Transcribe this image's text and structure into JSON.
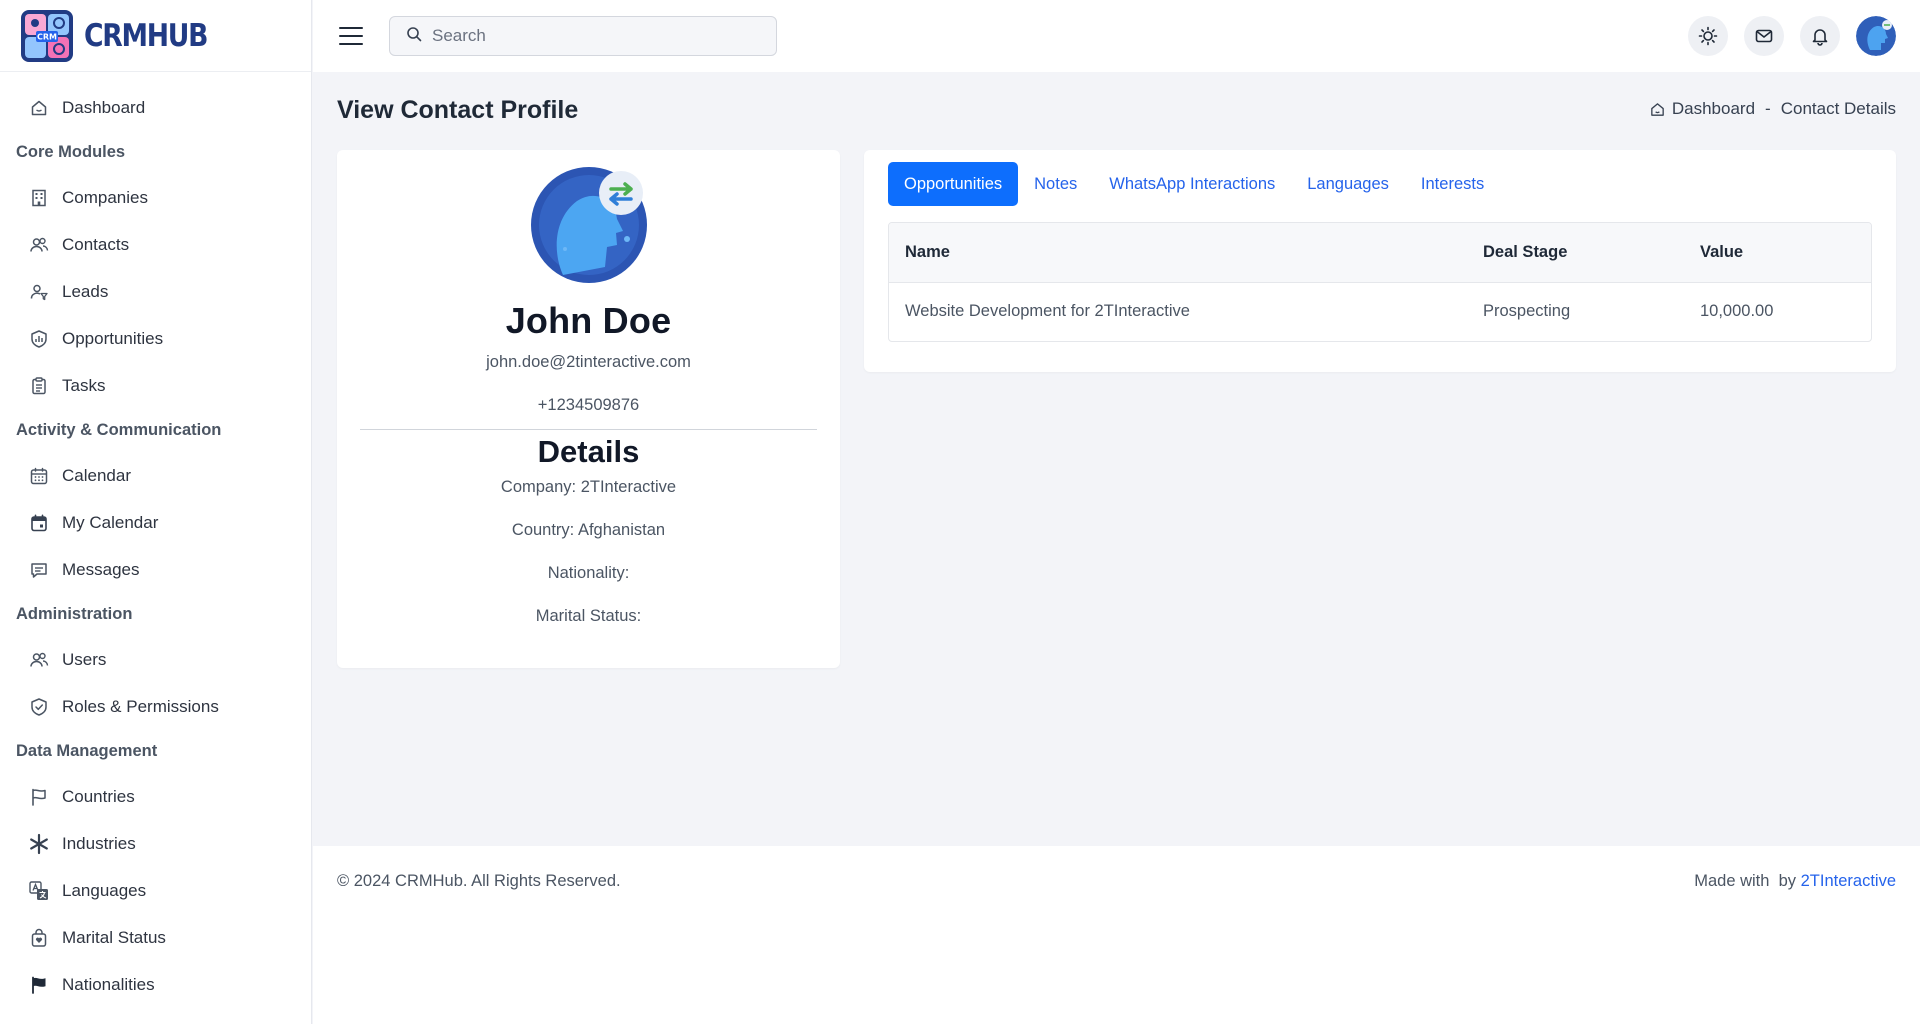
{
  "brand": {
    "name": "CRMHUB",
    "logo_badge": "CRM"
  },
  "sidebar": {
    "items": [
      {
        "type": "item",
        "label": "Dashboard",
        "icon": "home-icon"
      },
      {
        "type": "section",
        "label": "Core Modules"
      },
      {
        "type": "item",
        "label": "Companies",
        "icon": "building-icon"
      },
      {
        "type": "item",
        "label": "Contacts",
        "icon": "users-icon"
      },
      {
        "type": "item",
        "label": "Leads",
        "icon": "user-filter-icon"
      },
      {
        "type": "item",
        "label": "Opportunities",
        "icon": "chart-shield-icon"
      },
      {
        "type": "item",
        "label": "Tasks",
        "icon": "clipboard-icon"
      },
      {
        "type": "section",
        "label": "Activity & Communication"
      },
      {
        "type": "item",
        "label": "Calendar",
        "icon": "calendar-icon"
      },
      {
        "type": "item",
        "label": "My Calendar",
        "icon": "calendar-event-icon"
      },
      {
        "type": "item",
        "label": "Messages",
        "icon": "message-icon"
      },
      {
        "type": "section",
        "label": "Administration"
      },
      {
        "type": "item",
        "label": "Users",
        "icon": "users-icon"
      },
      {
        "type": "item",
        "label": "Roles & Permissions",
        "icon": "shield-check-icon"
      },
      {
        "type": "section",
        "label": "Data Management"
      },
      {
        "type": "item",
        "label": "Countries",
        "icon": "flag-icon"
      },
      {
        "type": "item",
        "label": "Industries",
        "icon": "asterisk-icon"
      },
      {
        "type": "item",
        "label": "Languages",
        "icon": "language-icon"
      },
      {
        "type": "item",
        "label": "Marital Status",
        "icon": "bag-heart-icon"
      },
      {
        "type": "item",
        "label": "Nationalities",
        "icon": "flag-filled-icon"
      }
    ]
  },
  "topbar": {
    "search_placeholder": "Search",
    "actions": [
      "theme-toggle-icon",
      "mail-icon",
      "bell-icon",
      "user-avatar"
    ]
  },
  "page": {
    "title": "View Contact Profile",
    "breadcrumb": {
      "home": "Dashboard",
      "separator": "-",
      "current": "Contact Details"
    }
  },
  "profile": {
    "name": "John Doe",
    "email": "john.doe@2tinteractive.com",
    "phone": "+1234509876",
    "details_heading": "Details",
    "details": [
      "Company: 2TInteractive",
      "Country: Afghanistan",
      "Nationality:",
      "Marital Status:"
    ]
  },
  "tabs": {
    "items": [
      "Opportunities",
      "Notes",
      "WhatsApp Interactions",
      "Languages",
      "Interests"
    ],
    "active": "Opportunities"
  },
  "opportunities_table": {
    "headers": [
      "Name",
      "Deal Stage",
      "Value"
    ],
    "rows": [
      [
        "Website Development for 2TInteractive",
        "Prospecting",
        "10,000.00"
      ]
    ]
  },
  "footer": {
    "copyright": "© 2024 CRMHub. All Rights Reserved.",
    "made_with": "Made with  by ",
    "made_by": "2TInteractive"
  },
  "colors": {
    "accent": "#0d6efd",
    "link": "#2563eb",
    "brand_text": "#213b84",
    "page_bg": "#f3f4f8"
  }
}
